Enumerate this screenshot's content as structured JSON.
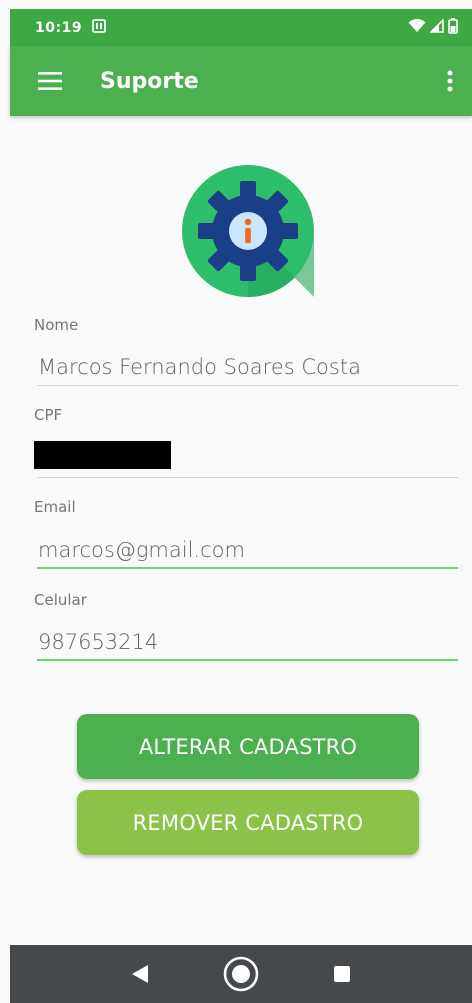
{
  "status_bar": {
    "time": "10:19"
  },
  "app_bar": {
    "title": "Suporte"
  },
  "form": {
    "name_label": "Nome",
    "name_value": "Marcos Fernando Soares Costa",
    "cpf_label": "CPF",
    "email_label": "Email",
    "email_value": "marcos@gmail.com",
    "phone_label": "Celular",
    "phone_value": "987653214"
  },
  "buttons": {
    "alter_label": "ALTERAR CADASTRO",
    "remove_label": "REMOVER CADASTRO"
  },
  "icons": {
    "menu": "hamburger-menu-icon",
    "more": "more-vert-icon",
    "logo": "gear-info-icon",
    "nav_back": "back-triangle-icon",
    "nav_home": "home-circle-icon",
    "nav_recents": "recents-square-icon"
  },
  "colors": {
    "status_bar": "#3ea843",
    "app_bar": "#4caf50",
    "button_alter": "#4caf50",
    "button_remove": "#8bc34a",
    "nav_bar": "#45494c"
  }
}
